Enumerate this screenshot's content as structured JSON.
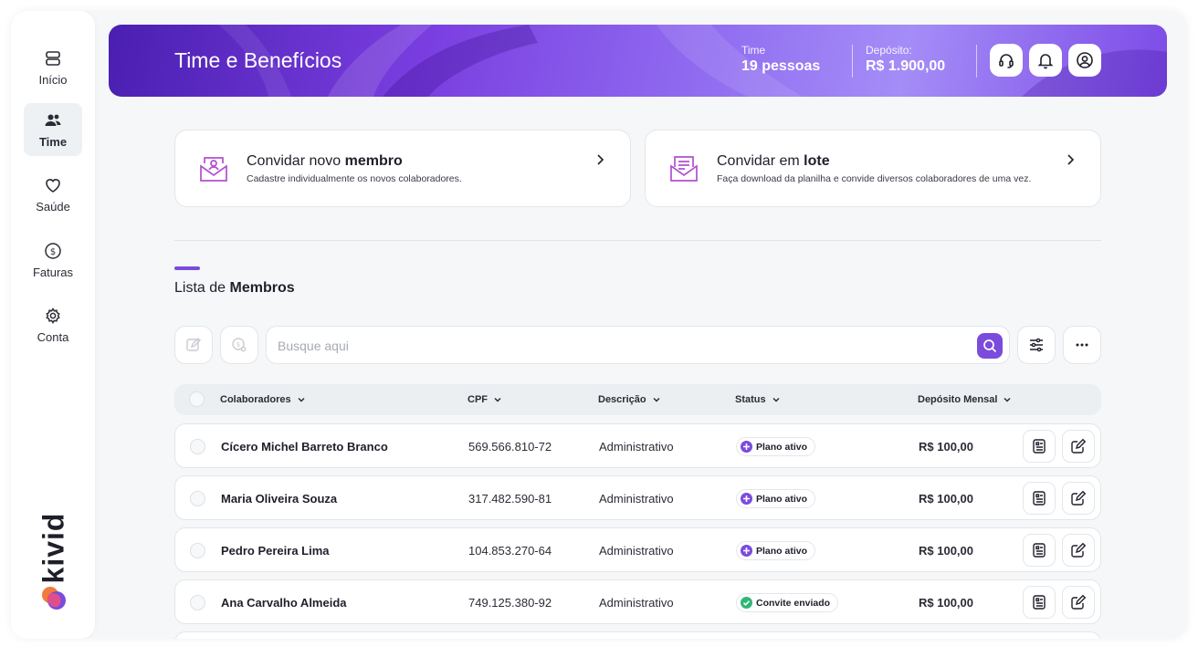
{
  "sidebar": {
    "items": [
      {
        "label": "Início",
        "icon": "stack-icon"
      },
      {
        "label": "Time",
        "icon": "users-icon",
        "active": true
      },
      {
        "label": "Saúde",
        "icon": "heart-icon"
      },
      {
        "label": "Faturas",
        "icon": "dollar-icon"
      },
      {
        "label": "Conta",
        "icon": "gear-icon"
      }
    ],
    "logo_text": "kivid"
  },
  "header": {
    "title_prefix": "Time e ",
    "title_bold": "Benefícios",
    "team_label": "Time",
    "team_value": "19 pessoas",
    "deposit_label": "Depósito:",
    "deposit_value": "R$ 1.900,00",
    "icons": [
      "headset-icon",
      "bell-icon",
      "user-icon"
    ]
  },
  "invites": [
    {
      "title_prefix": "Convidar novo ",
      "title_bold": "membro",
      "subtitle": "Cadastre individualmente os novos colaboradores."
    },
    {
      "title_prefix": "Convidar em ",
      "title_bold": "lote",
      "subtitle": "Faça download da planilha e convide diversos colaboradores de uma vez."
    }
  ],
  "list": {
    "title_prefix": "Lista de ",
    "title_bold": "Membros"
  },
  "search": {
    "placeholder": "Busque aqui"
  },
  "table": {
    "headers": [
      "Colaboradores",
      "CPF",
      "Descrição",
      "Status",
      "Depósito Mensal"
    ],
    "rows": [
      {
        "name": "Cícero Michel Barreto Branco",
        "cpf": "569.566.810-72",
        "desc": "Administrativo",
        "status": "Plano ativo",
        "deposit": "R$ 100,00"
      },
      {
        "name": "Maria Oliveira Souza",
        "cpf": "317.482.590-81",
        "desc": "Administrativo",
        "status": "Plano ativo",
        "deposit": "R$ 100,00"
      },
      {
        "name": "Pedro Pereira Lima",
        "cpf": "104.853.270-64",
        "desc": "Administrativo",
        "status": "Plano ativo",
        "deposit": "R$ 100,00"
      },
      {
        "name": "Ana Carvalho Almeida",
        "cpf": "749.125.380-92",
        "desc": "Administrativo",
        "status": "Convite enviado",
        "deposit": "R$ 100,00"
      }
    ]
  },
  "colors": {
    "accent": "#7b4bdc",
    "status_active": "#7b4bdc",
    "status_sent": "#2fb774"
  }
}
